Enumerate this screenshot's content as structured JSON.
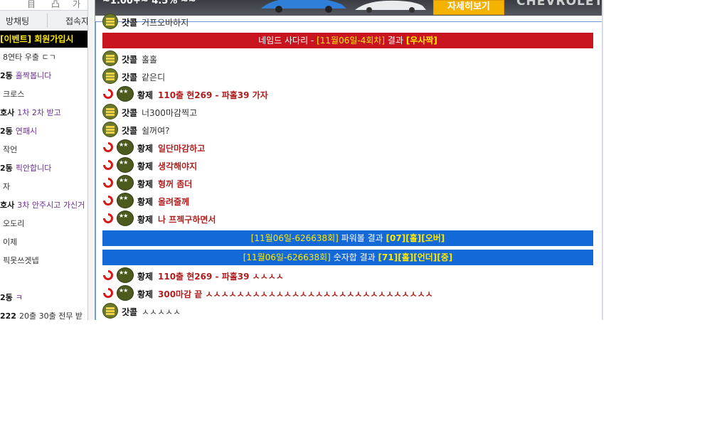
{
  "left": {
    "top_icons": [
      "目",
      "凸",
      "가"
    ],
    "tabs": [
      "방채팅",
      "접속자"
    ],
    "event_text": "[이벤트] 회원가입시",
    "rows": [
      {
        "nick": "",
        "msg": "",
        "plain": "8연타 우출 ㄷㄱ"
      },
      {
        "nick": "2동",
        "msg": "홀짝봅니다",
        "plain": ""
      },
      {
        "nick": "",
        "msg": "",
        "plain": "크로스"
      },
      {
        "nick": "호사",
        "msg": "1차 2차 받고",
        "plain": ""
      },
      {
        "nick": "2동",
        "msg": "연패시",
        "plain": ""
      },
      {
        "nick": "",
        "msg": "",
        "plain": "작언"
      },
      {
        "nick": "2동",
        "msg": "픽안합니다",
        "plain": ""
      },
      {
        "nick": "",
        "msg": "",
        "plain": "자"
      },
      {
        "nick": "호사",
        "msg": "3차 안주시고 가신거",
        "plain": ""
      },
      {
        "nick": "",
        "msg": "",
        "plain": "오도리"
      },
      {
        "nick": "",
        "msg": "",
        "plain": "이제"
      },
      {
        "nick": "",
        "msg": "",
        "plain": "픽못쓰겟넵"
      },
      {
        "nick": "",
        "msg": "",
        "plain": ""
      },
      {
        "nick": "2동",
        "msg": "ㅋ",
        "plain": ""
      },
      {
        "nick": "222",
        "msg": "",
        "plain": "20출 30출 전무 받"
      }
    ]
  },
  "ad": {
    "text": "~1.00+~ 4.5% ~~",
    "button": "자세히보기",
    "brand": "CHEVROLET"
  },
  "chat": {
    "partial_top": {
      "nick": "갓콜",
      "text": "거프오바하지"
    },
    "result_ladder": {
      "prefix": "네임드 사다리 - ",
      "round": "[11월06일-4회차]",
      "mid": " 결과 ",
      "result": "[우사짝]"
    },
    "messages_a": [
      {
        "badge": "rank",
        "nick": "갓콜",
        "text": "홀홀",
        "red": false
      },
      {
        "badge": "rank",
        "nick": "갓콜",
        "text": "같은디",
        "red": false
      },
      {
        "badge": "general",
        "nick": "황제",
        "text": "110출 현269 - 파홀39 가자",
        "red": true
      },
      {
        "badge": "rank",
        "nick": "갓콜",
        "text": "너300마감찍고",
        "red": false
      },
      {
        "badge": "rank",
        "nick": "갓콜",
        "text": "쉴꺼여?",
        "red": false
      },
      {
        "badge": "general",
        "nick": "황제",
        "text": "일단마감하고",
        "red": true
      },
      {
        "badge": "general",
        "nick": "황제",
        "text": "생각해야지",
        "red": true
      },
      {
        "badge": "general",
        "nick": "황제",
        "text": "형꺼 좀더",
        "red": true
      },
      {
        "badge": "general",
        "nick": "황제",
        "text": "올려줄께",
        "red": true
      },
      {
        "badge": "general",
        "nick": "황제",
        "text": "나 프젝구하면서",
        "red": true
      }
    ],
    "result_powerball": {
      "round": "[11월06일-626638회]",
      "mid": " 파워볼 결과 ",
      "r1": "[07]",
      "r2": "[홀]",
      "r3": "[오버]"
    },
    "result_sum": {
      "round": "[11월06일-626638회]",
      "mid": " 숫자합 결과 ",
      "r1": "[71]",
      "r2": "[홀]",
      "r3": "[언더]",
      "r4": "[중]"
    },
    "messages_b": [
      {
        "badge": "general",
        "nick": "황제",
        "text": "110출 현269 - 파홀39 ㅅㅅㅅㅅ",
        "red": true
      },
      {
        "badge": "general",
        "nick": "황제",
        "text": "300마감 끝 ㅅㅅㅅㅅㅅㅅㅅㅅㅅㅅㅅㅅㅅㅅㅅㅅㅅㅅㅅㅅㅅㅅㅅㅅㅅㅅㅅㅅㅅ",
        "red": true
      },
      {
        "badge": "rank",
        "nick": "갓콜",
        "text": "ㅅㅅㅅㅅㅅ",
        "red": false
      }
    ]
  },
  "colors": {
    "sys_red": "#c8141e",
    "sys_blue": "#1469d8",
    "highlight": "#ffe900",
    "purple_msg": "#6a2c91",
    "red_msg": "#b02020"
  }
}
